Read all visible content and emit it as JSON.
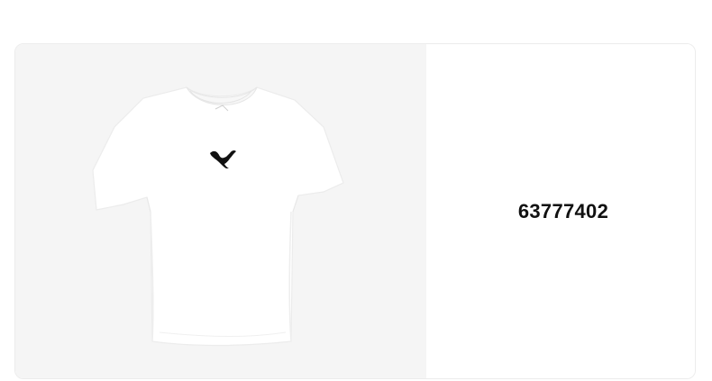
{
  "product": {
    "code": "63777402",
    "image": {
      "name": "white-tshirt-image",
      "logo": "puma-cat-logo-icon"
    }
  },
  "colors": {
    "image_background": "#f5f5f5",
    "shirt": "#ffffff",
    "shirt_shadow": "#e9e9e9",
    "logo": "#111111",
    "card_border": "#ececec"
  }
}
